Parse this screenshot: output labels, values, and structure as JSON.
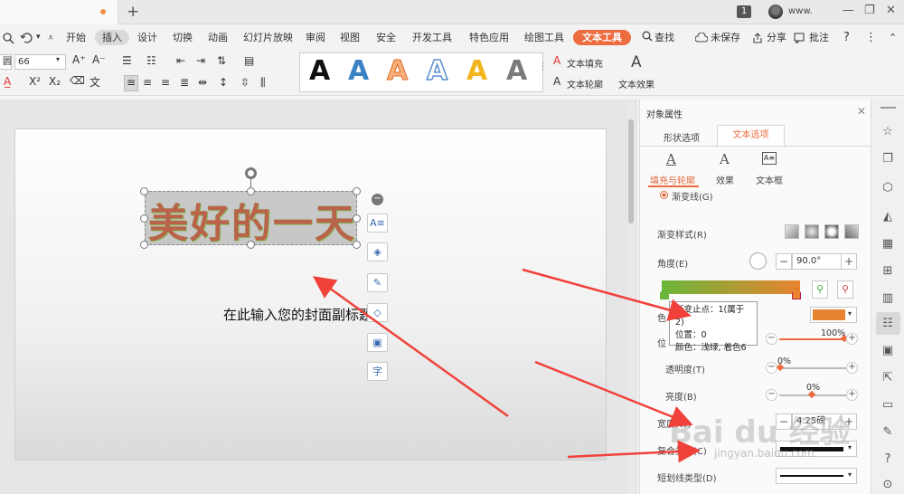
{
  "titlebar": {
    "window_count": "1",
    "user_name": "www.",
    "controls": [
      "—",
      "❐",
      "✕"
    ]
  },
  "menu": {
    "items": [
      "开始",
      "插入",
      "设计",
      "切换",
      "动画",
      "幻灯片放映",
      "审阅",
      "视图",
      "安全",
      "开发工具",
      "特色应用",
      "绘图工具",
      "文本工具"
    ],
    "search": "查找",
    "save_status": "未保存",
    "share": "分享",
    "comment": "批注",
    "help": "?"
  },
  "ribbon": {
    "font_size": "66",
    "font_grow": "A⁺",
    "font_shrink": "A⁻",
    "text_fill": "文本填充",
    "text_outline": "文本轮廓",
    "text_effects": "文本效果",
    "style_letter": "A",
    "style_colors": [
      "#111111",
      "#3b82c4",
      "#f08a4b",
      "#5b8fd0",
      "#f2b51e",
      "#7a7a7a"
    ]
  },
  "slide": {
    "title": "美好的一天",
    "subtitle": "在此输入您的封面副标题"
  },
  "panel": {
    "title": "对象属性",
    "tab_shape": "形状选项",
    "tab_text": "文本选项",
    "subtab_fill_outline": "填充与轮廓",
    "subtab_effects": "效果",
    "subtab_textbox": "文本框",
    "gradient_line": "渐变线(G)",
    "gradient_style": "渐变样式(R)",
    "angle_label": "角度(E)",
    "angle_value": "90.0°",
    "color_label": "色",
    "position_label": "位",
    "position_value": "100%",
    "transparency_label": "透明度(T)",
    "transparency_value": "0%",
    "brightness_label": "亮度(B)",
    "brightness_value": "0%",
    "width_label": "宽度(W)",
    "width_value": "4.25磅",
    "compound_label": "复合类型(C)",
    "dash_label": "短划线类型(D)",
    "stop_color": "#e8832f",
    "gradient_colors": [
      "#6bb63a",
      "#e8832f"
    ],
    "tooltip": {
      "line1": "渐变止点：1(属于 2)",
      "line2": "位置：0",
      "line3": "颜色：浅绿, 着色6"
    }
  },
  "watermark": {
    "brand": "Bai du 经验",
    "url": "jingyan.baidu.com"
  },
  "colors": {
    "accent": "#ec6b3f",
    "arrow": "#f0413a"
  }
}
